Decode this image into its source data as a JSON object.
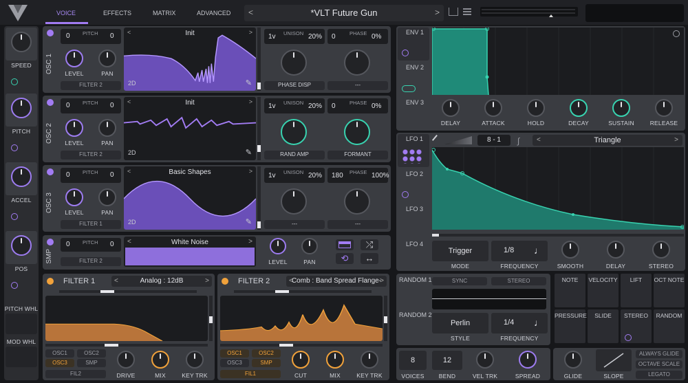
{
  "header": {
    "tabs": [
      "VOICE",
      "EFFECTS",
      "MATRIX",
      "ADVANCED"
    ],
    "active_tab": "VOICE",
    "preset_name": "*VLT Future Gun"
  },
  "macros": [
    {
      "label": "SPEED"
    },
    {
      "label": "PITCH"
    },
    {
      "label": "ACCEL"
    },
    {
      "label": "POS"
    }
  ],
  "wheels": {
    "pitch": "PITCH WHL",
    "mod": "MOD WHL"
  },
  "osc": [
    {
      "name": "OSC 1",
      "pitch_l": "0",
      "pitch_r": "0",
      "pitch_label": "PITCH",
      "level": "LEVEL",
      "pan": "PAN",
      "filter": "FILTER 2",
      "wavetable": "Init",
      "dim": "2D",
      "unison_v": "1v",
      "unison_label": "UNISON",
      "unison_pct": "20%",
      "phase_v": "0",
      "phase_label": "PHASE",
      "phase_pct": "0%",
      "sel_l": "PHASE DISP",
      "sel_r": "---"
    },
    {
      "name": "OSC 2",
      "pitch_l": "0",
      "pitch_r": "0",
      "pitch_label": "PITCH",
      "level": "LEVEL",
      "pan": "PAN",
      "filter": "FILTER 2",
      "wavetable": "Init",
      "dim": "2D",
      "unison_v": "1v",
      "unison_label": "UNISON",
      "unison_pct": "20%",
      "phase_v": "0",
      "phase_label": "PHASE",
      "phase_pct": "0%",
      "sel_l": "RAND AMP",
      "sel_r": "FORMANT"
    },
    {
      "name": "OSC 3",
      "pitch_l": "0",
      "pitch_r": "0",
      "pitch_label": "PITCH",
      "level": "LEVEL",
      "pan": "PAN",
      "filter": "FILTER 1",
      "wavetable": "Basic Shapes",
      "dim": "2D",
      "unison_v": "1v",
      "unison_label": "UNISON",
      "unison_pct": "20%",
      "phase_v": "180",
      "phase_label": "PHASE",
      "phase_pct": "100%",
      "sel_l": "---",
      "sel_r": "---"
    }
  ],
  "smp": {
    "name": "SMP",
    "pitch_l": "0",
    "pitch_r": "0",
    "pitch_label": "PITCH",
    "filter": "FILTER 2",
    "sample": "White Noise",
    "level": "LEVEL",
    "pan": "PAN"
  },
  "filter1": {
    "title": "FILTER 1",
    "model": "Analog : 12dB",
    "sources": [
      "OSC1",
      "OSC2",
      "OSC3",
      "SMP"
    ],
    "route": "FIL2",
    "knobs": [
      "DRIVE",
      "MIX",
      "KEY TRK"
    ]
  },
  "filter2": {
    "title": "FILTER 2",
    "model": "Comb : Band Spread Flange-",
    "sources": [
      "OSC1",
      "OSC2",
      "OSC3",
      "SMP"
    ],
    "route": "FIL1",
    "knobs": [
      "CUT",
      "MIX",
      "KEY TRK"
    ]
  },
  "env": {
    "tabs": [
      "ENV 1",
      "ENV 2",
      "ENV 3"
    ],
    "knobs": [
      "DELAY",
      "ATTACK",
      "HOLD",
      "DECAY",
      "SUSTAIN",
      "RELEASE"
    ]
  },
  "lfo": {
    "tabs": [
      "LFO 1",
      "LFO 2",
      "LFO 3",
      "LFO 4"
    ],
    "grid": "8 - 1",
    "shape": "Triangle",
    "mode": "Trigger",
    "mode_label": "MODE",
    "freq": "1/8",
    "freq_label": "FREQUENCY",
    "knobs": [
      "SMOOTH",
      "DELAY",
      "STEREO"
    ]
  },
  "random": {
    "tabs": [
      "RANDOM 1",
      "RANDOM 2"
    ],
    "sync": "SYNC",
    "stereo": "STEREO",
    "style": "Perlin",
    "style_label": "STYLE",
    "freq": "1/4",
    "freq_label": "FREQUENCY"
  },
  "mod_sources": [
    "NOTE",
    "VELOCITY",
    "LIFT",
    "OCT NOTE",
    "PRESSURE",
    "SLIDE",
    "STEREO",
    "RANDOM"
  ],
  "voice": {
    "voices": "8",
    "voices_label": "VOICES",
    "bend": "12",
    "bend_label": "BEND",
    "vel": "VEL TRK",
    "spread": "SPREAD",
    "glide": "GLIDE",
    "slope": "SLOPE",
    "opts": [
      "ALWAYS GLIDE",
      "OCTAVE SCALE",
      "LEGATO"
    ]
  },
  "colors": {
    "accent": "#a27cf3",
    "env": "#38d3b0",
    "filter": "#f1a23b",
    "bg": "#16171a",
    "panel": "#3a3c41"
  }
}
